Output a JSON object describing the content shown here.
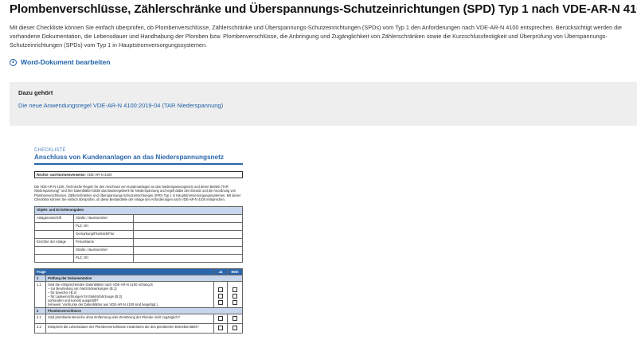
{
  "page": {
    "title": "Plombenverschlüsse, Zählerschränke und Überspannungs-Schutzeinrichtungen (SPD) Typ 1 nach VDE-AR-N 4100",
    "description": "Mit dieser Checkliste können Sie einfach überprüfen, ob Plombenverschlüsse, Zählerschränke und Überspannungs-Schutzeinrichtungen (SPDs) vom Typ 1 den Anforderungen nach VDE-AR-N 4100 entsprechen. Berücksichtigt werden die vorhandene Dokumentation, die Lebensdauer und Handhabung der Plomben bzw. Plombenverschlüsse, die Anbringung und Zugänglichkeit von Zählerschränken sowie die Kurzschlussfestigkeit und Überprüfung von Überspannungs-Schutzeinrichtungen (SPDs) vom Typ 1 in Hauptstromversorgungssystemen.",
    "word_link": "Word-Dokument bearbeiten",
    "related_label": "Dazu gehört",
    "related_link": "Die neue Anwendungsregel VDE-AR-N 4100:2019-04 (TAR Niederspannung)"
  },
  "icons": {
    "download": "download-circle-icon"
  },
  "colors": {
    "link": "#1d5fa8",
    "panel": "#eeeeee",
    "doc_blue": "#2a66ad",
    "doc_light": "#c7d6ec"
  },
  "preview": {
    "kicker": "CHECKLISTE",
    "title": "Anschluss von Kundenanlagen an das Niederspannungsnetz",
    "norm_label": "Rechts- und Normenverweise:",
    "norm_value": "VDE-AR-N 4100",
    "intro": "Die VDE-AR-N 4100 „Technische Regeln für den Anschluss von Kundenanlagen an das Niederspannungsnetz und deren Betrieb (TAR Niederspannung)“ und ihre Datenblätter bildet das Basisregelwerk für Niederspannung und regelt dabei den Einsatz und die Anordnung von Plombenverschlüssen, Zählerschränken und Überspannungs-Schutzeinrichtungen (SPD) Typ 1 in Hauptstromversorgungssystemen. Mit dieser Checkliste können Sie einfach überprüfen, ob diese Bestandteile der Anlage den Anforderungen nach VDE-AR-N 4100 entsprechen.",
    "object_header": "Objekt- und Errichterangaben",
    "object_rows": [
      {
        "group": "Anlagenanschrift",
        "field": "Straße, Hausnummer"
      },
      {
        "group": "",
        "field": "PLZ, Ort"
      },
      {
        "group": "",
        "field": "Gemarkung/Flurstück/Flur"
      },
      {
        "group": "Errichter der Anlage",
        "field": "Firma/Name"
      },
      {
        "group": "",
        "field": "Straße, Hausnummer"
      },
      {
        "group": "",
        "field": "PLZ, Ort"
      }
    ],
    "q_header": {
      "frage": "Frage",
      "ja": "Ja",
      "nein": "Nein"
    },
    "s1_no": "1",
    "s1_title": "Prüfung der Dokumentation",
    "q11_no": "1.1",
    "q11_lines": [
      "Sind die entsprechenden Datenblätter nach VDE-AR-N 4100 Anhang B",
      "– zur Beurteilung von Netzrückwirkungen (B.1)",
      "– für Speicher (B.2)",
      "– für Ladeeinrichtungen für Elektrofahrzeuge (B.3)",
      "vorhanden und korrekt ausgefüllt?",
      "(Hinweis: Vordrucke der Datenblätter aus VDE-AR-N 4100 sind beigefügt.)"
    ],
    "s2_no": "2",
    "s2_title": "Plombenverschlüsse",
    "q21_no": "2.1",
    "q21_text": "Sind plombierte Bereiche ohne Entfernung oder Zerstörung der Plombe nicht zugänglich?",
    "q22_no": "2.2",
    "q22_text": "Entspricht die Lebensdauer der Plombenverschlüsse mindestens der des plombierten Betriebsmittels?"
  }
}
